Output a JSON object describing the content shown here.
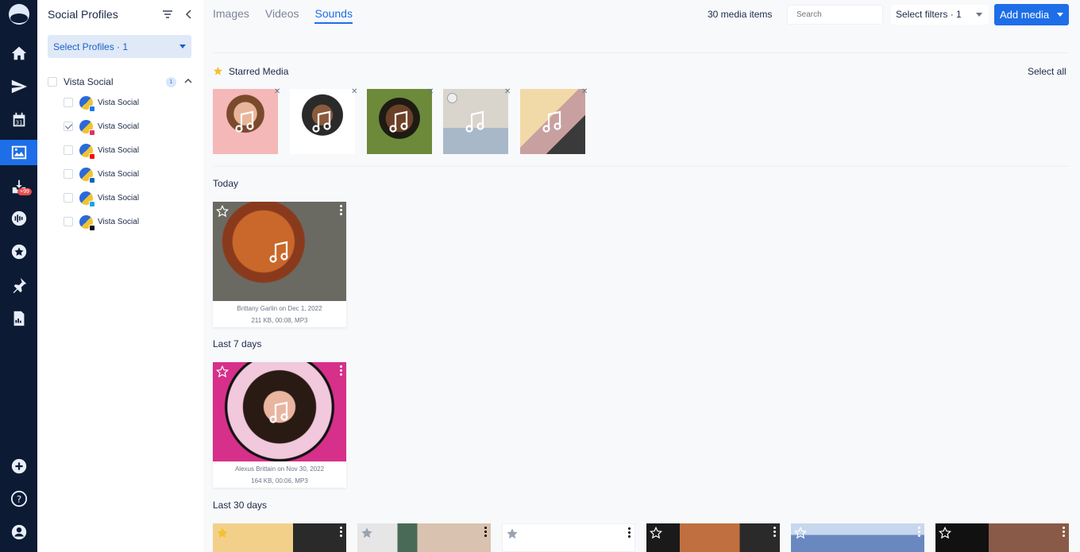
{
  "rail": {
    "badge": "+99"
  },
  "panel": {
    "title": "Social Profiles",
    "select_profiles": "Select Profiles · 1",
    "group": {
      "label": "Vista Social",
      "count": "1"
    },
    "profiles": [
      {
        "label": "Vista Social",
        "checked": false,
        "network": "facebook",
        "net_color": "#1877f2"
      },
      {
        "label": "Vista Social",
        "checked": true,
        "network": "instagram",
        "net_color": "#e1306c"
      },
      {
        "label": "Vista Social",
        "checked": false,
        "network": "youtube",
        "net_color": "#ff0000"
      },
      {
        "label": "Vista Social",
        "checked": false,
        "network": "linkedin",
        "net_color": "#0a66c2"
      },
      {
        "label": "Vista Social",
        "checked": false,
        "network": "twitter",
        "net_color": "#1da1f2"
      },
      {
        "label": "Vista Social",
        "checked": false,
        "network": "tiktok",
        "net_color": "#111111"
      }
    ]
  },
  "header": {
    "tabs": [
      {
        "label": "Images",
        "active": false
      },
      {
        "label": "Videos",
        "active": false
      },
      {
        "label": "Sounds",
        "active": true
      }
    ],
    "media_count": "30 media items",
    "search_placeholder": "Search",
    "filters_label": "Select filters · 1",
    "add_media_label": "Add media"
  },
  "starred": {
    "title": "Starred Media",
    "select_all": "Select all"
  },
  "sections": {
    "today": "Today",
    "last7": "Last 7 days",
    "last30": "Last 30 days"
  },
  "cards": {
    "today": {
      "author": "Brittany Garlin on Dec 1, 2022",
      "details": "211 KB, 00:08, MP3"
    },
    "last7": {
      "author": "Alexus Brittain on Nov 30, 2022",
      "details": "164 KB, 00:06, MP3"
    }
  },
  "colors": {
    "accent": "#1e6ee8",
    "rail": "#0c1a33",
    "badge": "#e64a4a",
    "star": "#f2c230"
  }
}
